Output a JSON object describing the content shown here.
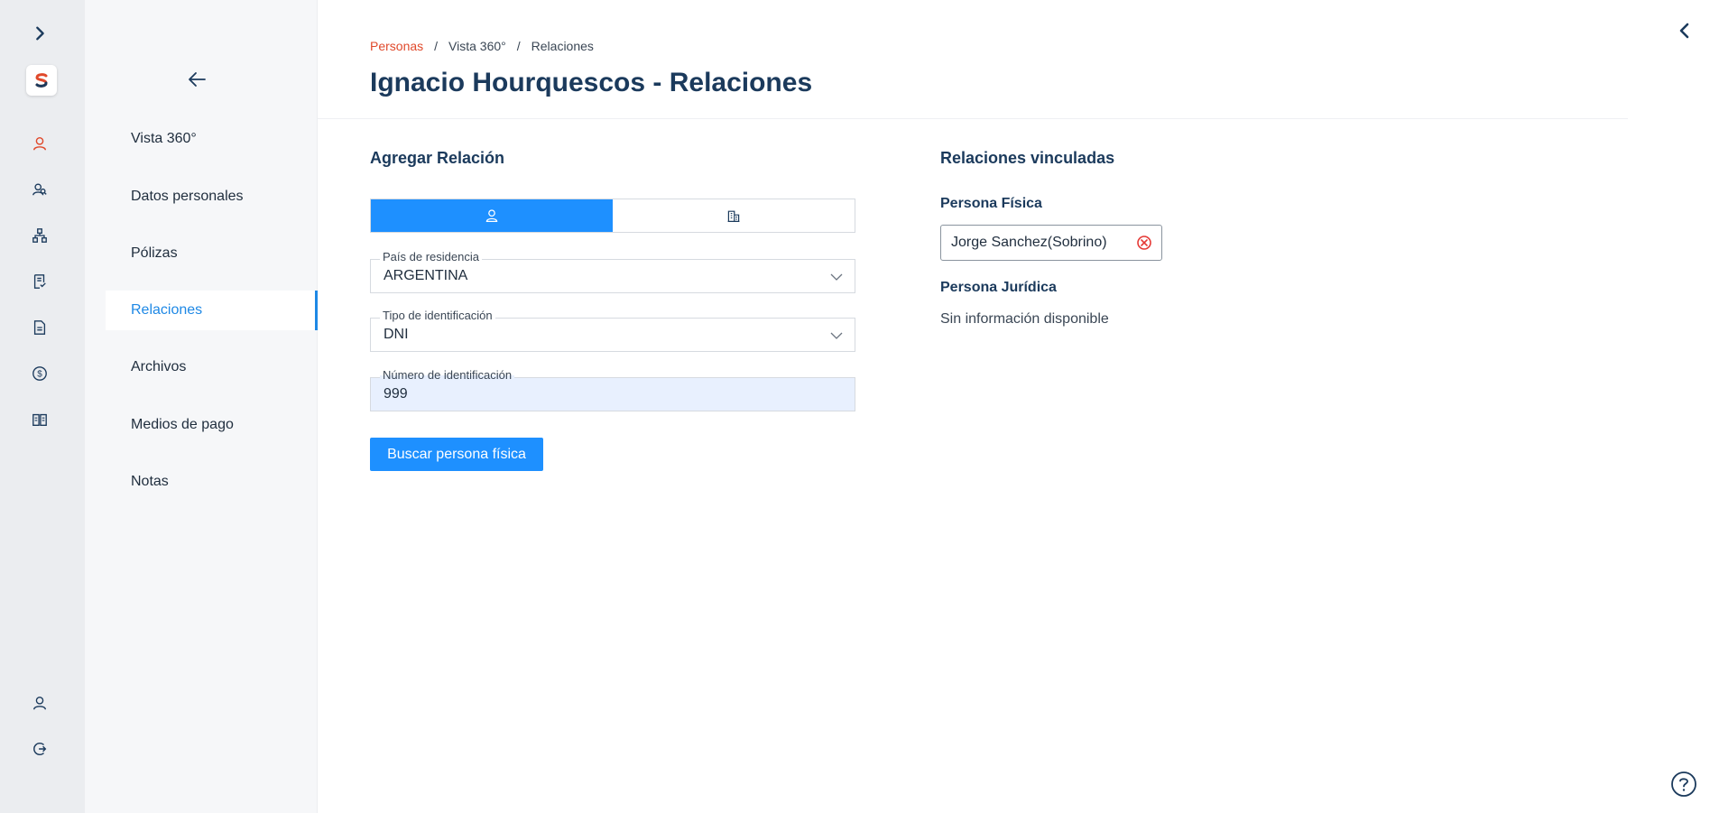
{
  "rail": {
    "items": [
      {
        "icon": "chevron-right-icon"
      },
      {
        "icon": "app-logo"
      },
      {
        "icon": "person-icon",
        "color": "#e0492b"
      },
      {
        "icon": "people-search-icon"
      },
      {
        "icon": "hierarchy-icon"
      },
      {
        "icon": "receipt-icon"
      },
      {
        "icon": "document-icon"
      },
      {
        "icon": "dollar-icon"
      },
      {
        "icon": "book-icon"
      },
      {
        "icon": "user-account-icon"
      },
      {
        "icon": "logout-icon"
      }
    ]
  },
  "subnav": {
    "items": [
      {
        "label": "Vista 360°"
      },
      {
        "label": "Datos personales"
      },
      {
        "label": "Pólizas"
      },
      {
        "label": "Relaciones",
        "active": true
      },
      {
        "label": "Archivos"
      },
      {
        "label": "Medios de pago"
      },
      {
        "label": "Notas"
      }
    ]
  },
  "breadcrumb": {
    "items": [
      "Personas",
      "Vista 360°",
      "Relaciones"
    ],
    "separator": "/"
  },
  "page": {
    "title": "Ignacio Hourquescos - Relaciones"
  },
  "add_relation": {
    "title": "Agregar Relación",
    "toggle": [
      {
        "icon": "person-icon",
        "active": true
      },
      {
        "icon": "building-icon",
        "active": false
      }
    ],
    "fields": {
      "country": {
        "label": "País de residencia",
        "value": "ARGENTINA"
      },
      "id_type": {
        "label": "Tipo de identificación",
        "value": "DNI"
      },
      "id_number": {
        "label": "Número de identificación",
        "value": "999"
      }
    },
    "search_button": "Buscar persona física"
  },
  "linked_relations": {
    "title": "Relaciones vinculadas",
    "natural_person_title": "Persona Física",
    "natural_persons": [
      "Jorge Sanchez(Sobrino)"
    ],
    "legal_person_title": "Persona Jurídica",
    "legal_persons_empty": "Sin información disponible"
  },
  "colors": {
    "accent": "#1e90ff",
    "brand": "#e0492b",
    "heading": "#1b3a5c",
    "remove": "#e53935"
  }
}
